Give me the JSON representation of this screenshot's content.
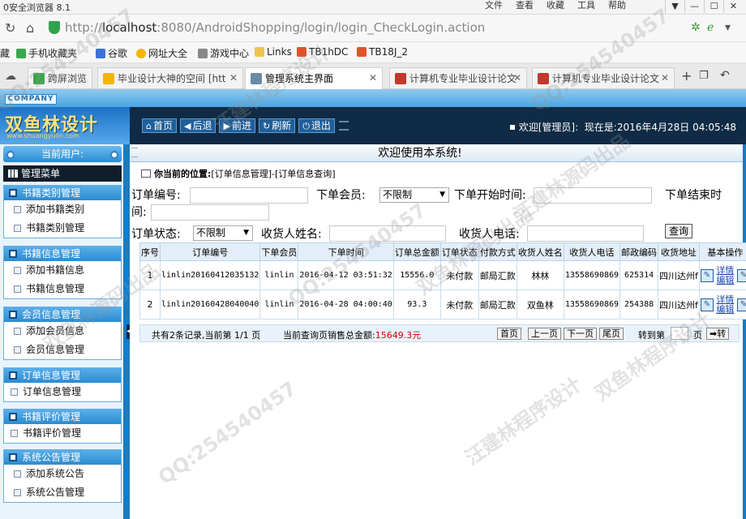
{
  "browser": {
    "app_title": "0安全浏览器 8.1",
    "menus": [
      "文件",
      "查看",
      "收藏",
      "工具",
      "帮助"
    ],
    "window_buttons": [
      "▼",
      "—",
      "☐",
      "✕"
    ],
    "url_host": "localhost",
    "url_rest": ":8080/AndroidShopping/login/login_CheckLogin.action",
    "url_prefix": "http://",
    "favorites": [
      {
        "label": "手机收藏夹",
        "color": "#37a84a"
      },
      {
        "label": "谷歌",
        "color": "#3a73d6"
      },
      {
        "label": "网址大全",
        "color": "#f3b600"
      },
      {
        "label": "游戏中心",
        "color": "#888888"
      },
      {
        "label": "Links",
        "color": "#f0c44c"
      },
      {
        "label": "TB1hDC",
        "color": "#e0542b"
      },
      {
        "label": "TB18J_2",
        "color": "#e0542b"
      }
    ],
    "favbar_prefix": "藏",
    "tabs": [
      {
        "label": "跨屏浏览",
        "color": "#37a84a"
      },
      {
        "label": "毕业设计大神的空间 [htt",
        "color": "#f3b600"
      },
      {
        "label": "管理系统主界面",
        "color": "#6b8aa8"
      },
      {
        "label": "计算机专业毕业设计论文",
        "color": "#c0392b"
      },
      {
        "label": "计算机专业毕业设计论文",
        "color": "#c0392b"
      }
    ]
  },
  "header": {
    "company_tag": "COMPANY",
    "logo_text": "双鱼林设计",
    "logo_url": "www.shuangyulin.com",
    "nav": [
      {
        "icon": "⌂",
        "label": "首页"
      },
      {
        "icon": "◀",
        "label": "后退"
      },
      {
        "icon": "▶",
        "label": "前进"
      },
      {
        "icon": "↻",
        "label": "刷新"
      },
      {
        "icon": "⏻",
        "label": "退出"
      }
    ],
    "welcome_user": "欢迎[管理员]:",
    "now_label": "现在是:",
    "now_value": "2016年4月28日 04:05:48"
  },
  "sidebar": {
    "current_user": "当前用户:",
    "menu_title": "管理菜单",
    "groups": [
      {
        "title": "书籍类别管理",
        "items": [
          "添加书籍类别",
          "书籍类别管理"
        ]
      },
      {
        "title": "书籍信息管理",
        "items": [
          "添加书籍信息",
          "书籍信息管理"
        ]
      },
      {
        "title": "会员信息管理",
        "items": [
          "添加会员信息",
          "会员信息管理"
        ]
      },
      {
        "title": "订单信息管理",
        "items": [
          "订单信息管理"
        ]
      },
      {
        "title": "书籍评价管理",
        "items": [
          "书籍评价管理"
        ]
      },
      {
        "title": "系统公告管理",
        "items": [
          "添加系统公告",
          "系统公告管理"
        ]
      }
    ]
  },
  "main": {
    "welcome": "欢迎使用本系统!",
    "location_label": "你当前的位置:",
    "location_path": "[订单信息管理]-[订单信息查询]",
    "search": {
      "order_no_label": "订单编号:",
      "member_label": "下单会员:",
      "member_value": "不限制",
      "start_label": "下单开始时间:",
      "end_label": "下单结束时",
      "end_label_wrap": "间:",
      "status_label": "订单状态:",
      "status_value": "不限制",
      "receiver_label": "收货人姓名:",
      "phone_label": "收货人电话:",
      "query_button": "查询"
    },
    "table": {
      "headers": [
        "序号",
        "订单编号",
        "下单会员",
        "下单时间",
        "订单总金额",
        "订单状态",
        "付款方式",
        "收货人姓名",
        "收货人电话",
        "邮政编码",
        "收货地址",
        "基本操作"
      ],
      "rows": [
        [
          "1",
          "linlin20160412035132",
          "linlin",
          "2016-04-12 03:51:32",
          "15556.0",
          "未付款",
          "邮局汇款",
          "林林",
          "13558690869",
          "625314",
          "四川达州f"
        ],
        [
          "2",
          "linlin20160428040040",
          "linlin",
          "2016-04-28 04:00:40",
          "93.3",
          "未付款",
          "邮局汇款",
          "双鱼林",
          "13558690869",
          "254388",
          "四川达州f"
        ]
      ],
      "op_detail": "详情",
      "op_edit": "编辑"
    },
    "pager": {
      "info": "共有2条记录,当前第 1/1 页",
      "sales_label": "当前查询页销售总金额:",
      "sales_value": "15649.3元",
      "buttons": [
        "首页",
        "上一页",
        "下一页",
        "尾页"
      ],
      "goto_label": "转到第",
      "page_unit": "页",
      "go_button": "➡转"
    }
  },
  "watermarks": [
    "QQ:254540457",
    "双鱼林源码出品",
    "汪建林程序设计",
    "双鱼林程序设计",
    "QQ:254540457",
    "汪建林源码出品",
    "QQ:254540457",
    "双鱼林源码出品",
    "汪建林程序设计",
    "QQ:254540457"
  ]
}
